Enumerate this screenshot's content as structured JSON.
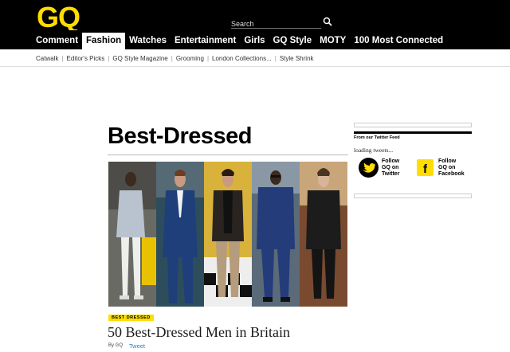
{
  "header": {
    "logo_text": "GQ",
    "search": {
      "placeholder": "Search"
    }
  },
  "nav": {
    "items": [
      "Comment",
      "Fashion",
      "Watches",
      "Entertainment",
      "Girls",
      "GQ Style",
      "MOTY",
      "100 Most Connected"
    ],
    "active": "Fashion"
  },
  "subnav": {
    "items": [
      "Catwalk",
      "Editor's Picks",
      "GQ Style Magazine",
      "Grooming",
      "London Collections...",
      "Style Shrink"
    ]
  },
  "main": {
    "title": "Best-Dressed",
    "tag": "BEST DRESSED",
    "article_title": "50 Best-Dressed Men in Britain",
    "byline": "By GQ",
    "tweet_label": "Tweet"
  },
  "sidebar": {
    "feed_heading": "From our Twitter Feed",
    "loading_text": "loading tweets...",
    "follow_twitter": [
      "Follow",
      "GQ on",
      "Twitter"
    ],
    "follow_facebook": [
      "Follow",
      "GQ on",
      "Facebook"
    ]
  },
  "colors": {
    "brand_yellow": "#ffdd00",
    "header_bg": "#000000",
    "link_blue": "#1d7fd4"
  }
}
